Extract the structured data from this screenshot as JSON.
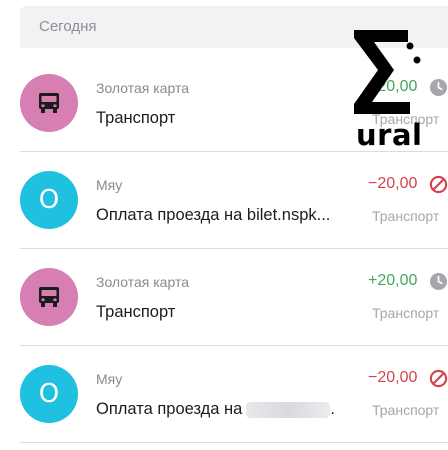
{
  "section": {
    "label": "Сегодня"
  },
  "transactions": [
    {
      "source": "Золотая карта",
      "title": "Транспорт",
      "amount": "+20,00",
      "amount_type": "positive",
      "category": "Транспорт",
      "avatar": {
        "type": "icon",
        "icon": "bus-icon",
        "color": "#d77fb2"
      },
      "status_icon": "clock-icon"
    },
    {
      "source": "Мяу",
      "title": "Оплата проезда на bilet.nspk...",
      "amount": "−20,00",
      "amount_type": "negative",
      "category": "Транспорт",
      "avatar": {
        "type": "letter",
        "letter": "О",
        "color": "#1fc0e0"
      },
      "status_icon": "cancel-icon"
    },
    {
      "source": "Золотая карта",
      "title": "Транспорт",
      "amount": "+20,00",
      "amount_type": "positive",
      "category": "Транспорт",
      "avatar": {
        "type": "icon",
        "icon": "bus-icon",
        "color": "#d77fb2"
      },
      "status_icon": "clock-icon"
    },
    {
      "source": "Мяу",
      "title": "Оплата проезда на",
      "title_suffix": ".",
      "amount": "−20,00",
      "amount_type": "negative",
      "category": "Транспорт",
      "avatar": {
        "type": "letter",
        "letter": "О",
        "color": "#1fc0e0"
      },
      "status_icon": "cancel-icon"
    }
  ],
  "watermark": {
    "text": "ural"
  },
  "colors": {
    "positive": "#43a85d",
    "negative": "#d6414d",
    "pink_avatar": "#d77fb2",
    "cyan_avatar": "#1fc0e0"
  }
}
